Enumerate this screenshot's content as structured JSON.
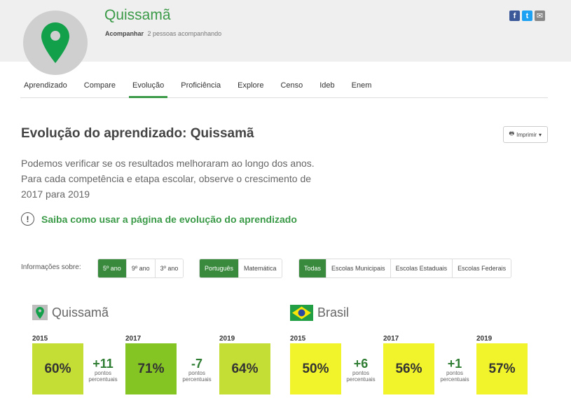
{
  "header": {
    "city_name": "Quissamã",
    "follow_label": "Acompanhar",
    "followers_text": "2 pessoas acompanhando",
    "social": [
      {
        "icon": "facebook-icon",
        "glyph": "f",
        "color": "#3b5998"
      },
      {
        "icon": "twitter-icon",
        "glyph": "t",
        "color": "#1da1f2"
      },
      {
        "icon": "mail-icon",
        "glyph": "✉",
        "color": "#888888"
      }
    ]
  },
  "tabs": [
    "Aprendizado",
    "Compare",
    "Evolução",
    "Proficiência",
    "Explore",
    "Censo",
    "Ideb",
    "Enem"
  ],
  "active_tab": "Evolução",
  "main": {
    "title": "Evolução do aprendizado: Quissamã",
    "print_label": "Imprimir",
    "intro": "Podemos verificar se os resultados melhoraram ao longo dos anos. Para cada competência e etapa escolar, observe o crescimento de 2017 para 2019",
    "help_link": "Saiba como usar a página de evolução do aprendizado"
  },
  "filters": {
    "label": "Informações sobre:",
    "grade": {
      "options": [
        "5º ano",
        "9º ano",
        "3º ano"
      ],
      "selected": "5º ano"
    },
    "subject": {
      "options": [
        "Português",
        "Matemática"
      ],
      "selected": "Português"
    },
    "network": {
      "options": [
        "Todas",
        "Escolas Municipais",
        "Escolas Estaduais",
        "Escolas Federais"
      ],
      "selected": "Todas"
    }
  },
  "comparison": [
    {
      "region": "Quissamã",
      "flag": "pin-icon",
      "years": [
        {
          "year": "2015",
          "value": "60%",
          "color": "#c5de35"
        },
        {
          "year": "2017",
          "value": "71%",
          "color": "#84c523"
        },
        {
          "year": "2019",
          "value": "64%",
          "color": "#c5de35"
        }
      ],
      "deltas": [
        {
          "value": "+11",
          "unit": "pontos percentuais"
        },
        {
          "value": "-7",
          "unit": "pontos percentuais"
        }
      ]
    },
    {
      "region": "Brasil",
      "flag": "brazil-flag-icon",
      "years": [
        {
          "year": "2015",
          "value": "50%",
          "color": "#f1f42a"
        },
        {
          "year": "2017",
          "value": "56%",
          "color": "#f1f42a"
        },
        {
          "year": "2019",
          "value": "57%",
          "color": "#f1f42a"
        }
      ],
      "deltas": [
        {
          "value": "+6",
          "unit": "pontos percentuais"
        },
        {
          "value": "+1",
          "unit": "pontos percentuais"
        }
      ]
    }
  ],
  "colors": {
    "brand_green": "#3a9a47",
    "button_green": "#3a8a3e"
  }
}
